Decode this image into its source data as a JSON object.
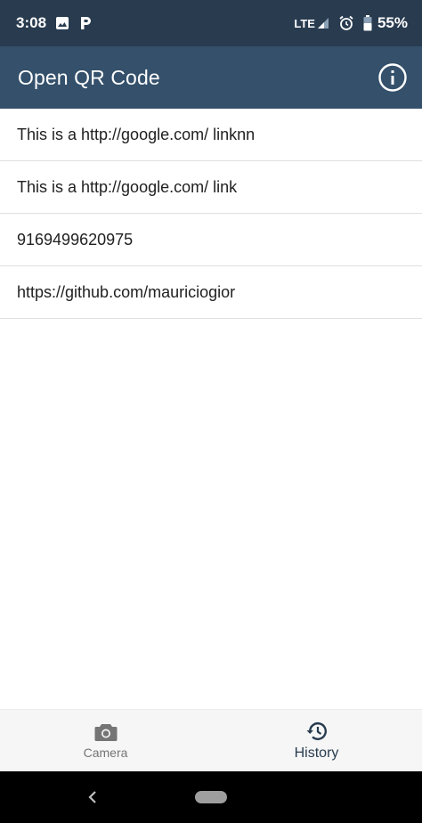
{
  "status_bar": {
    "time": "3:08",
    "network": "LTE",
    "battery": "55%"
  },
  "app_bar": {
    "title": "Open QR Code"
  },
  "history": {
    "items": [
      "This is a http://google.com/ linknn",
      "This is a http://google.com/ link",
      "9169499620975",
      "https://github.com/mauriciogior"
    ]
  },
  "bottom_nav": {
    "tabs": [
      {
        "label": "Camera",
        "icon": "camera-icon",
        "active": false
      },
      {
        "label": "History",
        "icon": "history-icon",
        "active": true
      }
    ]
  },
  "colors": {
    "status_bar_bg": "#283b4f",
    "app_bar_bg": "#34506b",
    "accent": "#283b4f"
  }
}
